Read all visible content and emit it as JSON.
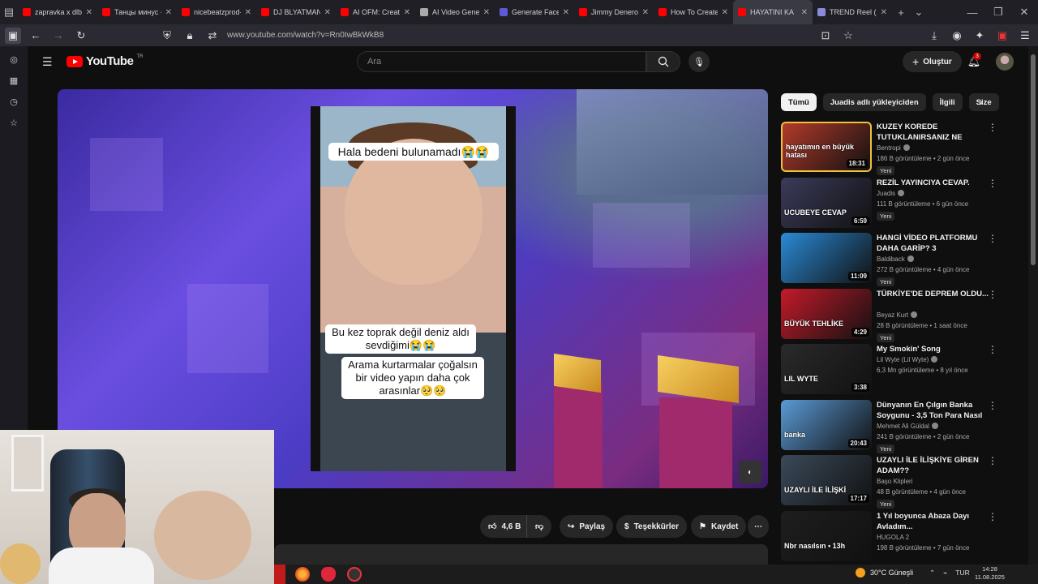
{
  "browser": {
    "tabs": [
      {
        "label": "zapravka x dlb -",
        "color": "#ff0000"
      },
      {
        "label": "Танцы минус - Г",
        "color": "#ff0000"
      },
      {
        "label": "nicebeatzprod-n",
        "color": "#ff0000"
      },
      {
        "label": "DJ BLYATMAN -",
        "color": "#ff0000"
      },
      {
        "label": "AI OFM: Create a",
        "color": "#ff0000"
      },
      {
        "label": "AI Video Generat",
        "color": "#aaaaaa"
      },
      {
        "label": "Generate Face |",
        "color": "#5b5bd6"
      },
      {
        "label": "Jimmy Denero -",
        "color": "#ff0000"
      },
      {
        "label": "How To Create R",
        "color": "#ff0000"
      },
      {
        "label": "HAYATINI KA",
        "color": "#ff0000"
      },
      {
        "label": "TREND Reel (Stra",
        "color": "#8a8ad6"
      }
    ],
    "active_tab_index": 9,
    "url": "www.youtube.com/watch?v=Rn0IwBkWkB8"
  },
  "youtube": {
    "logo_text": "YouTube",
    "logo_country": "TR",
    "search_placeholder": "Ara",
    "create_label": "Oluştur",
    "notification_count": "3"
  },
  "video": {
    "captions": [
      "Hala bedeni bulunamadı😭😭",
      "Bu kez toprak değil deniz aldı sevdiğimi😭😭",
      "Arama kurtarmalar çoğalsın bir video yapın daha çok arasınlar🥺🥺"
    ]
  },
  "actions": {
    "like_count": "4,6 B",
    "share": "Paylaş",
    "thanks": "Teşekkürler",
    "save": "Kaydet"
  },
  "filter_chips": [
    "Tümü",
    "Juadis adlı yükleyiciden",
    "İlgili",
    "Size"
  ],
  "related": [
    {
      "title": "KUZEY KOREDE TUTUKLANIRSANIZ NE OLUR?",
      "channel": "Bentropi",
      "verified": true,
      "meta": "186 B görüntüleme • 2 gün önce",
      "new": "Yeni",
      "duration": "18:31",
      "thumb_text": "hayatımın en büyük hatası",
      "thumb_color": "#b23a2a"
    },
    {
      "title": "REZİL YAYINCIYA CEVAP.",
      "channel": "Juadis",
      "verified": true,
      "meta": "111 B görüntüleme • 6 gün önce",
      "new": "Yeni",
      "duration": "6:59",
      "thumb_text": "UCUBEYE CEVAP",
      "thumb_color": "#3b3b5a"
    },
    {
      "title": "HANGİ VİDEO PLATFORMU DAHA GARİP? 3",
      "channel": "Baldiback",
      "verified": true,
      "meta": "272 B görüntüleme • 4 gün önce",
      "new": "Yeni",
      "duration": "11:09",
      "thumb_text": "",
      "thumb_color": "#2a8ad6"
    },
    {
      "title": "TÜRKİYE'DE DEPREM OLDU...",
      "channel": "Beyaz Kurt",
      "verified": true,
      "meta": "28 B görüntüleme • 1 saat önce",
      "new": "Yeni",
      "duration": "4:29",
      "thumb_text": "BÜYÜK TEHLİKE",
      "thumb_color": "#c41a2a"
    },
    {
      "title": "My Smokin' Song",
      "channel": "Lil Wyte (Lil Wyte)",
      "verified": true,
      "meta": "6,3 Mn görüntüleme • 8 yıl önce",
      "new": "",
      "duration": "3:38",
      "thumb_text": "LIL WYTE",
      "thumb_color": "#2a2a2a"
    },
    {
      "title": "Dünyanın En Çılgın Banka Soygunu - 3,5 Ton Para Nasıl ...",
      "channel": "Mehmet Ali Güldal",
      "verified": true,
      "meta": "241 B görüntüleme • 2 gün önce",
      "new": "Yeni",
      "duration": "20:43",
      "thumb_text": "banka",
      "thumb_color": "#5a9ad6"
    },
    {
      "title": "UZAYLI İLE İLİŞKİYE GİREN ADAM??",
      "channel": "Başo Klipleri",
      "verified": false,
      "meta": "48 B görüntüleme • 4 gün önce",
      "new": "Yeni",
      "duration": "17:17",
      "thumb_text": "UZAYLI İLE İLİŞKİ",
      "thumb_color": "#3a4a5a"
    },
    {
      "title": "1 Yıl boyunca Abaza Dayı Avladım...",
      "channel": "HUGOLA 2",
      "verified": false,
      "meta": "198 B görüntüleme • 7 gün önce",
      "new": "",
      "duration": "",
      "thumb_text": "Nbr nasılsın • 13h",
      "thumb_color": "#1e1e1e"
    }
  ],
  "taskbar": {
    "weather": "30°C  Güneşli",
    "lang": "TUR",
    "time": "14:28",
    "date": "11.08.2025"
  }
}
